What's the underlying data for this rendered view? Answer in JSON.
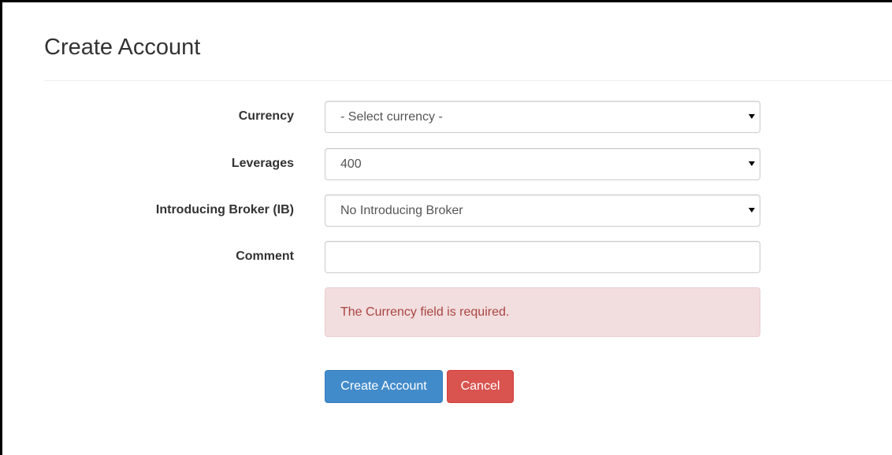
{
  "page": {
    "title": "Create Account"
  },
  "form": {
    "currency": {
      "label": "Currency",
      "value": "- Select currency -"
    },
    "leverages": {
      "label": "Leverages",
      "value": "400"
    },
    "ib": {
      "label": "Introducing Broker (IB)",
      "value": "No Introducing Broker"
    },
    "comment": {
      "label": "Comment",
      "value": ""
    }
  },
  "alert": {
    "message": "The Currency field is required."
  },
  "buttons": {
    "create": "Create Account",
    "cancel": "Cancel"
  },
  "colors": {
    "primary": "#428bca",
    "danger": "#d9534f",
    "alert_bg": "#f2dede",
    "alert_text": "#a94442"
  }
}
